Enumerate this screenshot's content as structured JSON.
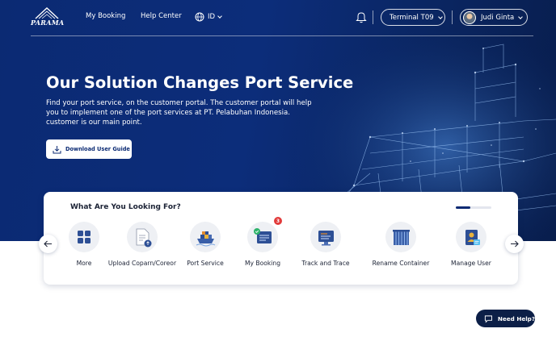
{
  "brand": {
    "logo_text": "PARAMA"
  },
  "nav": {
    "links": [
      "My Booking",
      "Help Center"
    ],
    "language": "ID",
    "terminal": "Terminal T09",
    "user_name": "Judi Ginta"
  },
  "hero": {
    "title": "Our Solution Changes Port Service",
    "description": "Find your port service, on the customer portal. The customer portal will help you to implement one of the port services at PT. Pelabuhan Indonesia. customer is our main point.",
    "guide_button": "Download User Guide"
  },
  "services": {
    "title": "What Are You Looking For?",
    "scroll_progress": 0.4,
    "items": [
      {
        "label": "More",
        "icon": "grid-icon"
      },
      {
        "label": "Upload Coparn/Coreor",
        "icon": "upload-document-icon"
      },
      {
        "label": "Port Service",
        "icon": "ship-icon"
      },
      {
        "label": "My Booking",
        "icon": "booking-icon",
        "badge": "3"
      },
      {
        "label": "Track and Trace",
        "icon": "monitor-icon"
      },
      {
        "label": "Rename Container",
        "icon": "container-icon"
      },
      {
        "label": "Manage User",
        "icon": "user-card-icon"
      }
    ]
  },
  "help": {
    "label": "Need Help?"
  },
  "colors": {
    "primary": "#0b2a73",
    "badge": "#e23b3b",
    "help_bg": "#0c1f47"
  }
}
